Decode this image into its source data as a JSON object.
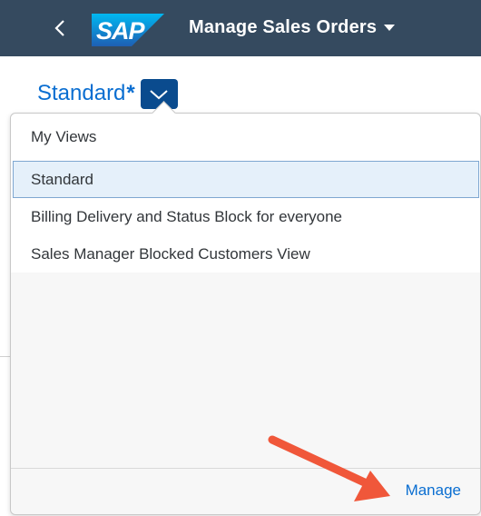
{
  "shell": {
    "logo_text": "SAP",
    "app_title": "Manage Sales Orders",
    "colors": {
      "header_bg": "#354a5f",
      "logo_blue": "#0a6ed1"
    }
  },
  "variant": {
    "name": "Standard",
    "modified_marker": "*"
  },
  "popover": {
    "header": "My Views",
    "items": [
      {
        "label": "Standard",
        "selected": true
      },
      {
        "label": "Billing Delivery and Status Block for everyone",
        "selected": false
      },
      {
        "label": "Sales Manager Blocked Customers View",
        "selected": false
      }
    ],
    "manage_label": "Manage"
  },
  "annotation": {
    "arrow_color": "#f0573a"
  }
}
